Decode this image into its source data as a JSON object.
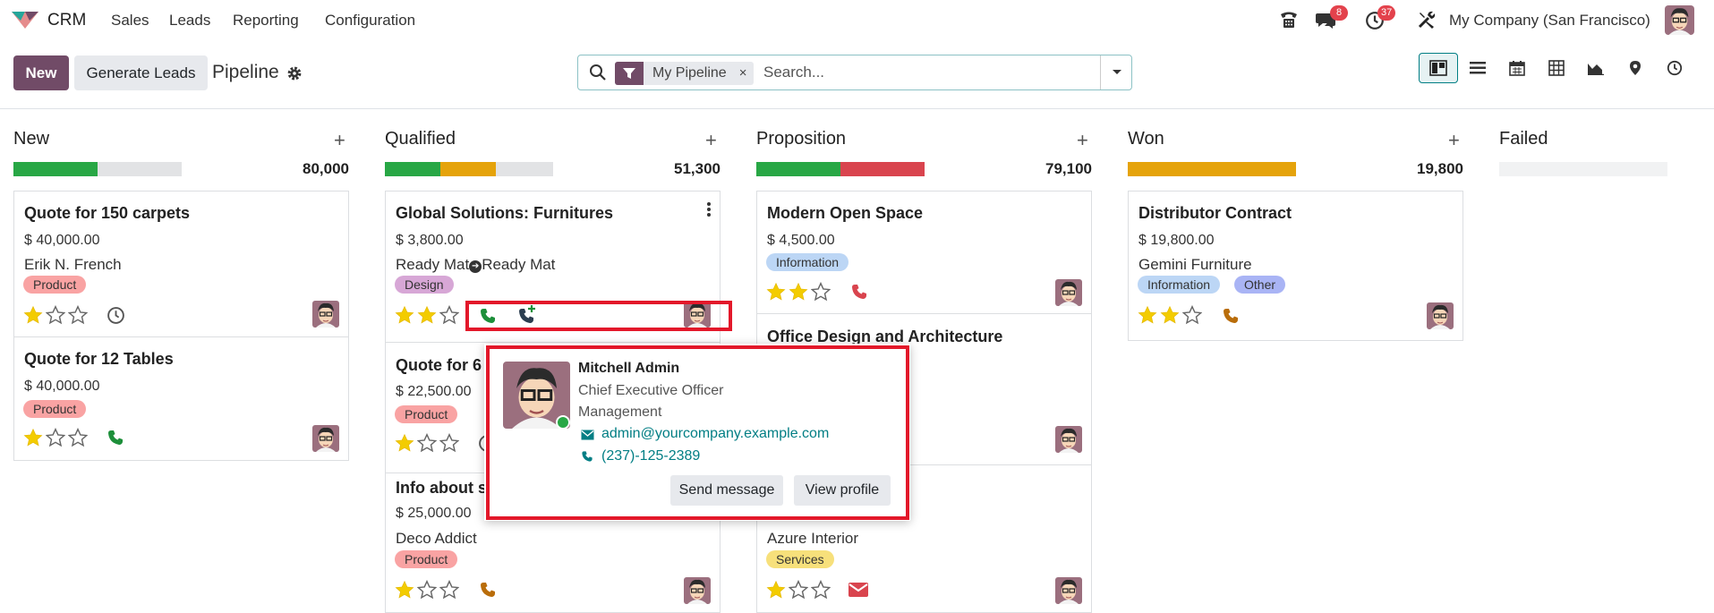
{
  "navbar": {
    "app_name": "CRM",
    "menu": [
      "Sales",
      "Leads",
      "Reporting",
      "Configuration"
    ],
    "messages_badge": "8",
    "activities_badge": "37",
    "company": "My Company (San Francisco)"
  },
  "control": {
    "new_label": "New",
    "generate_label": "Generate Leads",
    "breadcrumb": "Pipeline",
    "facet_label": "My Pipeline",
    "facet_remove": "×",
    "search_placeholder": "Search..."
  },
  "columns": [
    {
      "title": "New",
      "total": "80,000",
      "progress": [
        {
          "color": "#28a745",
          "pct": 50
        },
        {
          "color": "#e2e3e5",
          "pct": 50
        }
      ]
    },
    {
      "title": "Qualified",
      "total": "51,300",
      "progress": [
        {
          "color": "#28a745",
          "pct": 33
        },
        {
          "color": "#e5a30b",
          "pct": 33
        },
        {
          "color": "#e2e3e5",
          "pct": 34
        }
      ]
    },
    {
      "title": "Proposition",
      "total": "79,100",
      "progress": [
        {
          "color": "#28a745",
          "pct": 50
        },
        {
          "color": "#d9444e",
          "pct": 50
        }
      ]
    },
    {
      "title": "Won",
      "total": "19,800",
      "progress": [
        {
          "color": "#e5a30b",
          "pct": 100
        }
      ]
    },
    {
      "title": "Failed",
      "total": "",
      "progress": []
    }
  ],
  "cards": {
    "new_1": {
      "title": "Quote for 150 carpets",
      "amount": "$ 40,000.00",
      "partner": "Erik N. French",
      "tag": "Product"
    },
    "new_2": {
      "title": "Quote for 12 Tables",
      "amount": "$ 40,000.00",
      "tag": "Product"
    },
    "q_1": {
      "title": "Global Solutions: Furnitures",
      "amount": "$ 3,800.00",
      "partner": "Ready Mat",
      "partner2": "Ready Mat",
      "tag": "Design"
    },
    "q_2": {
      "title": "Quote for 6",
      "amount": "$ 22,500.00",
      "tag": "Product"
    },
    "q_3": {
      "title": "Info about s",
      "amount": "$ 25,000.00",
      "partner": "Deco Addict",
      "tag": "Product"
    },
    "p_1": {
      "title": "Modern Open Space",
      "amount": "$ 4,500.00",
      "tag": "Information"
    },
    "p_2": {
      "title": "Office Design and Architecture"
    },
    "p_3": {
      "partner": "Azure Interior",
      "tag": "Services"
    },
    "w_1": {
      "title": "Distributor Contract",
      "amount": "$ 19,800.00",
      "partner": "Gemini Furniture",
      "tag1": "Information",
      "tag2": "Other"
    }
  },
  "popover": {
    "name": "Mitchell Admin",
    "job": "Chief Executive Officer",
    "department": "Management",
    "email": "admin@yourcompany.example.com",
    "phone": "(237)-125-2389",
    "send_label": "Send message",
    "view_label": "View profile"
  },
  "colors": {
    "brand": "#714b67",
    "accent": "#017e84",
    "highlight": "#e3182a",
    "star": "#f3cc00"
  }
}
